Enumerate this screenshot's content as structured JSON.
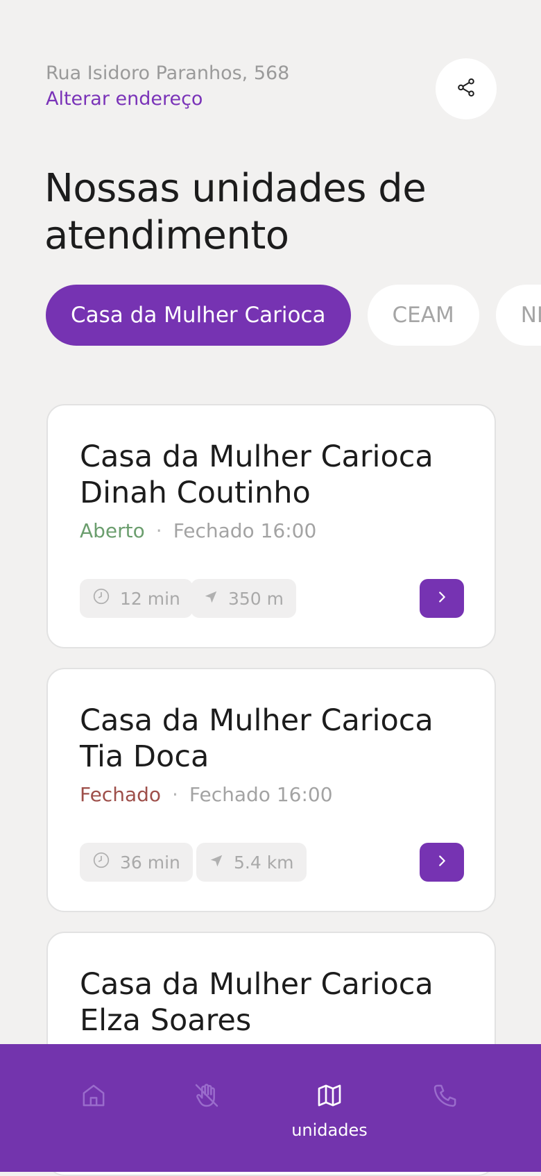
{
  "header": {
    "address": "Rua Isidoro Paranhos, 568",
    "change_address": "Alterar endereço"
  },
  "page_title": "Nossas unidades de atendimento",
  "filters": [
    "Casa da Mulher Carioca",
    "CEAM",
    "NEAM"
  ],
  "units": [
    {
      "name": "Casa da Mulher Carioca Dinah Coutinho",
      "status": "Aberto",
      "status_type": "open",
      "separator": "·",
      "hours": "Fechado 16:00",
      "time": "12 min",
      "distance": "350 m"
    },
    {
      "name": "Casa da Mulher Carioca Tia Doca",
      "status": "Fechado",
      "status_type": "closed",
      "separator": "·",
      "hours": "Fechado 16:00",
      "time": "36 min",
      "distance": "5.4 km"
    },
    {
      "name": "Casa da Mulher Carioca Elza Soares"
    }
  ],
  "nav": {
    "items": [
      {
        "icon": "home-icon",
        "label": ""
      },
      {
        "icon": "hand-icon",
        "label": ""
      },
      {
        "icon": "map-icon",
        "label": "unidades",
        "active": true
      },
      {
        "icon": "phone-icon",
        "label": ""
      }
    ]
  },
  "colors": {
    "accent": "#7633b2",
    "nav_bg": "#7334ad",
    "open": "#6b9e6e",
    "closed": "#9e4f4a",
    "background": "#f2f1f0"
  }
}
